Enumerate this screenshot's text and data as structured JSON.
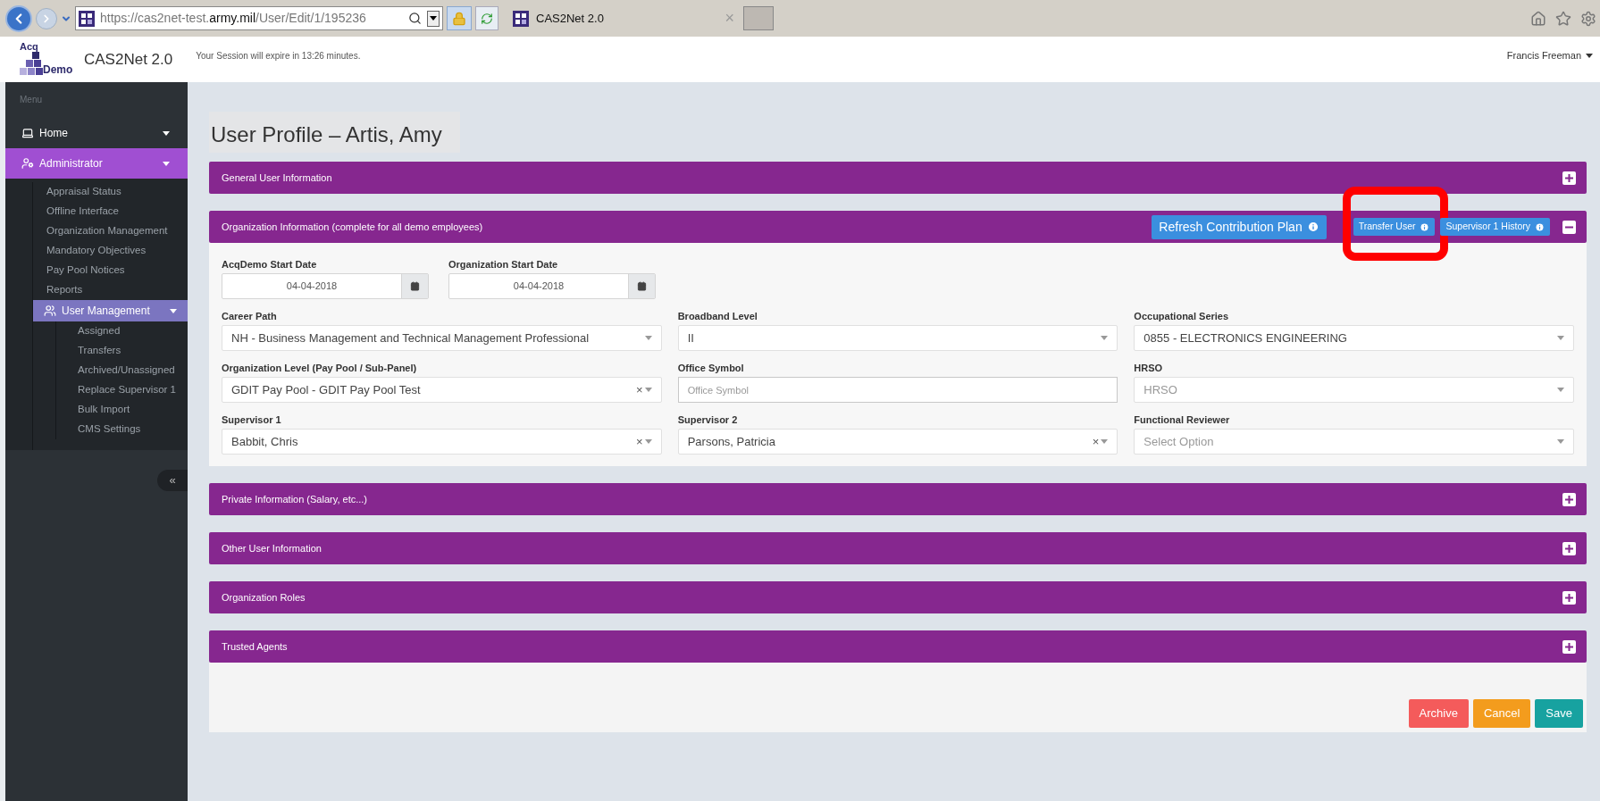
{
  "browser": {
    "url_scheme": "https://",
    "url_sub": "cas2net-test.",
    "url_domain": "army.mil",
    "url_path": "/User/Edit/1/195236",
    "tab_title": "CAS2Net 2.0",
    "tab_close": "×"
  },
  "header": {
    "logo_top": "Acq",
    "logo_bottom": "Demo",
    "app_name": "CAS2Net 2.0",
    "session_message": "Your Session will expire in 13:26 minutes.",
    "user_name": "Francis Freeman"
  },
  "sidebar": {
    "menu_label": "Menu",
    "collapse": "«",
    "items": [
      {
        "label": "Home",
        "selected": false
      },
      {
        "label": "Administrator",
        "selected": true,
        "children": [
          {
            "label": "Appraisal Status",
            "selected": false
          },
          {
            "label": "Offline Interface",
            "selected": false
          },
          {
            "label": "Organization Management",
            "selected": false
          },
          {
            "label": "Mandatory Objectives",
            "selected": false
          },
          {
            "label": "Pay Pool Notices",
            "selected": false
          },
          {
            "label": "Reports",
            "selected": false
          },
          {
            "label": "User Management",
            "selected": true,
            "children": [
              {
                "label": "Assigned",
                "selected": false
              },
              {
                "label": "Transfers",
                "selected": false
              },
              {
                "label": "Archived/Unassigned",
                "selected": false
              },
              {
                "label": "Replace Supervisor 1",
                "selected": false
              },
              {
                "label": "Bulk Import",
                "selected": false
              },
              {
                "label": "CMS Settings",
                "selected": false
              }
            ]
          }
        ]
      }
    ]
  },
  "page_title": "User Profile – Artis, Amy",
  "panels": [
    {
      "title": "General User Information",
      "expanded": false
    },
    {
      "title": "Organization Information (complete for all demo employees)",
      "expanded": true,
      "actions": [
        {
          "label": "Refresh Contribution Plan",
          "kind": "large",
          "highlighted": false
        },
        {
          "label": "Transfer User",
          "kind": "small",
          "highlighted": true
        },
        {
          "label": "Supervisor 1 History",
          "kind": "small",
          "highlighted": false
        }
      ],
      "rows": [
        [
          {
            "kind": "date_pair",
            "dates": [
              {
                "label": "AcqDemo Start Date",
                "value": "04-04-2018"
              },
              {
                "label": "Organization Start Date",
                "value": "04-04-2018"
              }
            ]
          }
        ],
        [
          {
            "kind": "select",
            "label": "Career Path",
            "value": "NH - Business Management and Technical Management Professional"
          },
          {
            "kind": "select",
            "label": "Broadband Level",
            "value": "II"
          },
          {
            "kind": "select",
            "label": "Occupational Series",
            "value": "0855 - ELECTRONICS ENGINEERING"
          }
        ],
        [
          {
            "kind": "select",
            "label": "Organization Level (Pay Pool / Sub-Panel)",
            "value": "GDIT Pay Pool - GDIT Pay Pool Test",
            "clear": "×"
          },
          {
            "kind": "text",
            "label": "Office Symbol",
            "placeholder": "Office Symbol"
          },
          {
            "kind": "select",
            "label": "HRSO",
            "placeholder": "HRSO"
          }
        ],
        [
          {
            "kind": "select",
            "label": "Supervisor 1",
            "value": "Babbit, Chris",
            "clear": "×"
          },
          {
            "kind": "select",
            "label": "Supervisor 2",
            "value": "Parsons, Patricia",
            "clear": "×"
          },
          {
            "kind": "select",
            "label": "Functional Reviewer",
            "placeholder": "Select Option"
          }
        ]
      ]
    },
    {
      "title": "Private Information (Salary, etc...)",
      "expanded": false
    },
    {
      "title": "Other User Information",
      "expanded": false
    },
    {
      "title": "Organization Roles",
      "expanded": false
    },
    {
      "title": "Trusted Agents",
      "expanded": false
    }
  ],
  "buttons": [
    {
      "label": "Archive",
      "color": "#f45b5b"
    },
    {
      "label": "Cancel",
      "color": "#f39c1d"
    },
    {
      "label": "Save",
      "color": "#17a2a0"
    }
  ]
}
